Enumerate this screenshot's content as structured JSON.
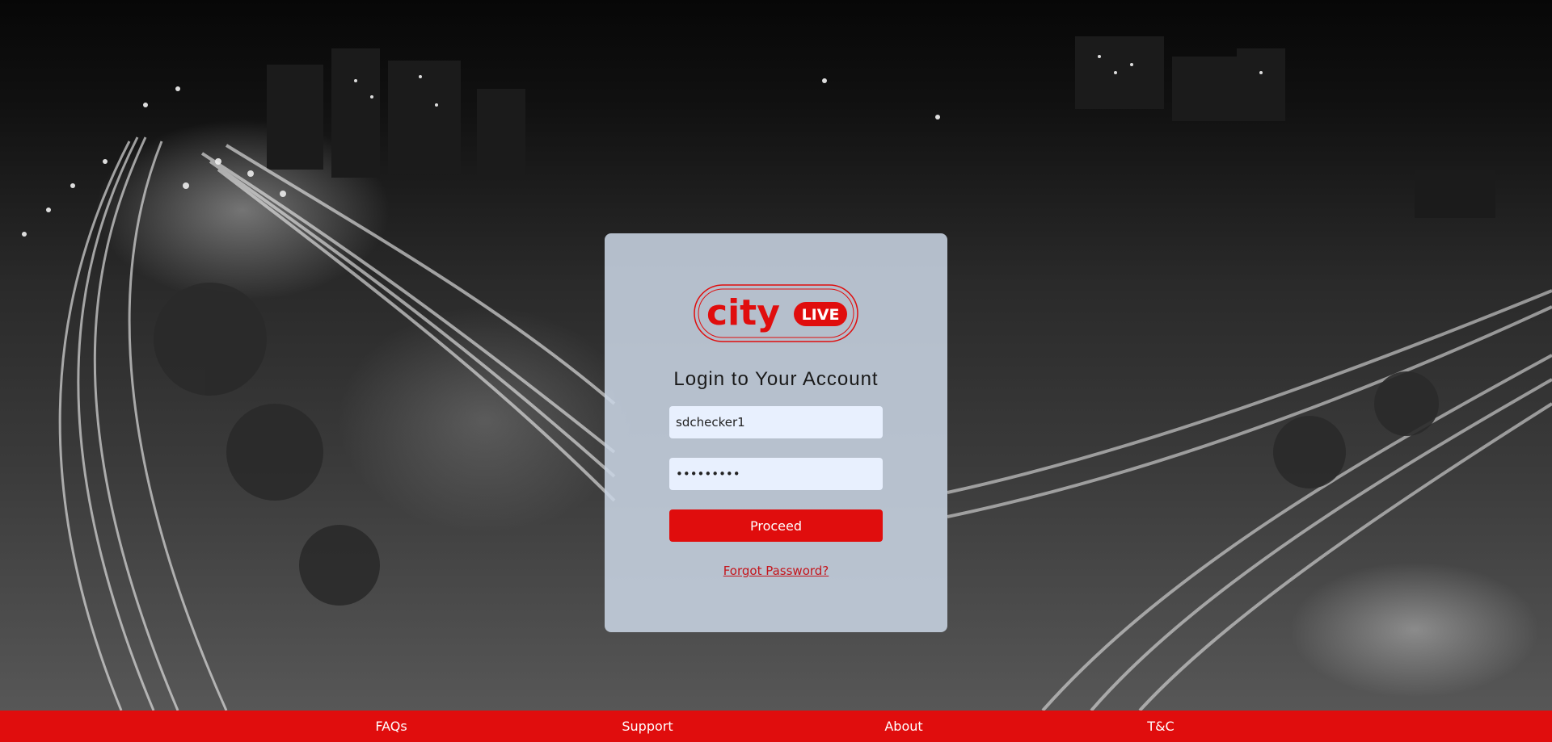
{
  "brand": {
    "logo_text": "city",
    "logo_badge": "LIVE",
    "accent_color": "#e00d0d"
  },
  "login": {
    "title": "Login to Your Account",
    "username_value": "sdchecker1",
    "password_value": "sdchecker",
    "proceed_label": "Proceed",
    "forgot_label": "Forgot Password?"
  },
  "footer": {
    "links": [
      {
        "label": "FAQs"
      },
      {
        "label": "Support"
      },
      {
        "label": "About"
      },
      {
        "label": "T&C"
      }
    ]
  },
  "background": {
    "icon": "city-night-light-trails-image"
  }
}
